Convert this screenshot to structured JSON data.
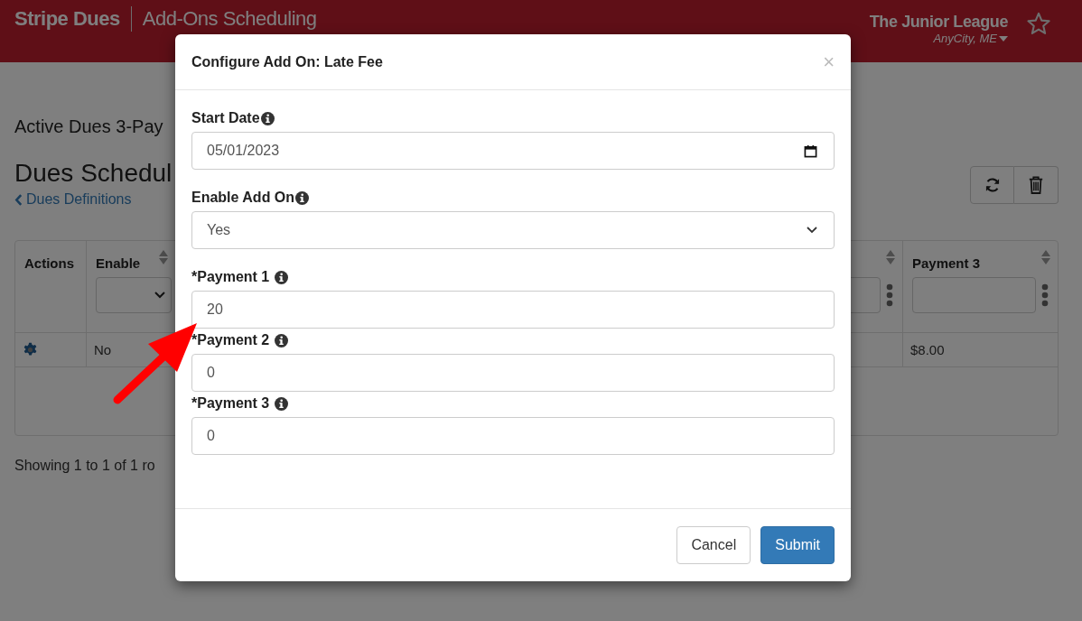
{
  "header": {
    "brand": "Stripe Dues",
    "page": "Add-Ons Scheduling",
    "org": "The Junior League",
    "location": "AnyCity, ME"
  },
  "page": {
    "subtitle": "Active Dues 3-Pay",
    "heading": "Dues Schedul",
    "back_link": "Dues Definitions",
    "showing": "Showing 1 to 1 of 1 ro"
  },
  "table": {
    "columns": [
      {
        "kind": "plain",
        "label": "Actions"
      },
      {
        "kind": "select",
        "label": "Enable"
      },
      {
        "kind": "hidden"
      },
      {
        "kind": "text",
        "label": "Payment 3"
      }
    ],
    "rows": [
      {
        "enable": "No",
        "payment_3": "$8.00"
      }
    ]
  },
  "modal": {
    "title": "Configure Add On: Late Fee",
    "close": "×",
    "fields": [
      {
        "kind": "date",
        "label": "Start Date",
        "value": "05/01/2023"
      },
      {
        "kind": "select",
        "label": "Enable Add On",
        "value": "Yes"
      },
      {
        "kind": "text",
        "label": "*Payment 1",
        "value": "20"
      },
      {
        "kind": "text",
        "label": "*Payment 2",
        "value": "0"
      },
      {
        "kind": "text",
        "label": "*Payment 3",
        "value": "0"
      }
    ],
    "buttons": [
      {
        "kind": "secondary",
        "label": "Cancel"
      },
      {
        "kind": "primary",
        "label": "Submit"
      }
    ]
  }
}
